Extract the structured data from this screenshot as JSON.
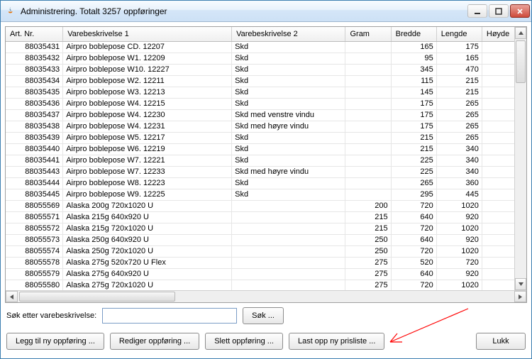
{
  "window": {
    "title": "Administrering. Totalt 3257 oppføringer"
  },
  "columns": [
    "Art. Nr.",
    "Varebeskrivelse 1",
    "Varebeskrivelse 2",
    "Gram",
    "Bredde",
    "Lengde",
    "Høyde"
  ],
  "rows": [
    {
      "art": "88035431",
      "v1": "Airpro boblepose CD. 12207",
      "v2": "Skd",
      "gram": "",
      "bredde": "165",
      "lengde": "175",
      "hoyde": ""
    },
    {
      "art": "88035432",
      "v1": "Airpro boblepose W1. 12209",
      "v2": "Skd",
      "gram": "",
      "bredde": "95",
      "lengde": "165",
      "hoyde": ""
    },
    {
      "art": "88035433",
      "v1": "Airpro boblepose W10. 12227",
      "v2": "Skd",
      "gram": "",
      "bredde": "345",
      "lengde": "470",
      "hoyde": ""
    },
    {
      "art": "88035434",
      "v1": "Airpro boblepose W2. 12211",
      "v2": "Skd",
      "gram": "",
      "bredde": "115",
      "lengde": "215",
      "hoyde": ""
    },
    {
      "art": "88035435",
      "v1": "Airpro boblepose W3. 12213",
      "v2": "Skd",
      "gram": "",
      "bredde": "145",
      "lengde": "215",
      "hoyde": ""
    },
    {
      "art": "88035436",
      "v1": "Airpro boblepose W4. 12215",
      "v2": "Skd",
      "gram": "",
      "bredde": "175",
      "lengde": "265",
      "hoyde": ""
    },
    {
      "art": "88035437",
      "v1": "Airpro boblepose W4. 12230",
      "v2": "Skd med venstre vindu",
      "gram": "",
      "bredde": "175",
      "lengde": "265",
      "hoyde": ""
    },
    {
      "art": "88035438",
      "v1": "Airpro boblepose W4. 12231",
      "v2": "Skd med høyre vindu",
      "gram": "",
      "bredde": "175",
      "lengde": "265",
      "hoyde": ""
    },
    {
      "art": "88035439",
      "v1": "Airpro boblepose W5. 12217",
      "v2": "Skd",
      "gram": "",
      "bredde": "215",
      "lengde": "265",
      "hoyde": ""
    },
    {
      "art": "88035440",
      "v1": "Airpro boblepose W6. 12219",
      "v2": "Skd",
      "gram": "",
      "bredde": "215",
      "lengde": "340",
      "hoyde": ""
    },
    {
      "art": "88035441",
      "v1": "Airpro boblepose W7. 12221",
      "v2": "Skd",
      "gram": "",
      "bredde": "225",
      "lengde": "340",
      "hoyde": ""
    },
    {
      "art": "88035443",
      "v1": "Airpro boblepose W7. 12233",
      "v2": "Skd med høyre vindu",
      "gram": "",
      "bredde": "225",
      "lengde": "340",
      "hoyde": ""
    },
    {
      "art": "88035444",
      "v1": "Airpro boblepose W8. 12223",
      "v2": "Skd",
      "gram": "",
      "bredde": "265",
      "lengde": "360",
      "hoyde": ""
    },
    {
      "art": "88035445",
      "v1": "Airpro boblepose W9. 12225",
      "v2": "Skd",
      "gram": "",
      "bredde": "295",
      "lengde": "445",
      "hoyde": ""
    },
    {
      "art": "88055569",
      "v1": "Alaska 200g 720x1020 U",
      "v2": "",
      "gram": "200",
      "bredde": "720",
      "lengde": "1020",
      "hoyde": ""
    },
    {
      "art": "88055571",
      "v1": "Alaska 215g 640x920 U",
      "v2": "",
      "gram": "215",
      "bredde": "640",
      "lengde": "920",
      "hoyde": ""
    },
    {
      "art": "88055572",
      "v1": "Alaska 215g 720x1020 U",
      "v2": "",
      "gram": "215",
      "bredde": "720",
      "lengde": "1020",
      "hoyde": ""
    },
    {
      "art": "88055573",
      "v1": "Alaska 250g 640x920 U",
      "v2": "",
      "gram": "250",
      "bredde": "640",
      "lengde": "920",
      "hoyde": ""
    },
    {
      "art": "88055574",
      "v1": "Alaska 250g 720x1020 U",
      "v2": "",
      "gram": "250",
      "bredde": "720",
      "lengde": "1020",
      "hoyde": ""
    },
    {
      "art": "88055578",
      "v1": "Alaska 275g 520x720 U Flex",
      "v2": "",
      "gram": "275",
      "bredde": "520",
      "lengde": "720",
      "hoyde": ""
    },
    {
      "art": "88055579",
      "v1": "Alaska 275g 640x920 U",
      "v2": "",
      "gram": "275",
      "bredde": "640",
      "lengde": "920",
      "hoyde": ""
    },
    {
      "art": "88055580",
      "v1": "Alaska 275g 720x1020 U",
      "v2": "",
      "gram": "275",
      "bredde": "720",
      "lengde": "1020",
      "hoyde": ""
    }
  ],
  "search": {
    "label": "Søk etter varebeskrivelse:",
    "value": "",
    "button": "Søk ..."
  },
  "buttons": {
    "add": "Legg til ny oppføring ...",
    "edit": "Rediger oppføring ...",
    "delete": "Slett oppføring ...",
    "upload": "Last opp ny prisliste ...",
    "close": "Lukk"
  }
}
